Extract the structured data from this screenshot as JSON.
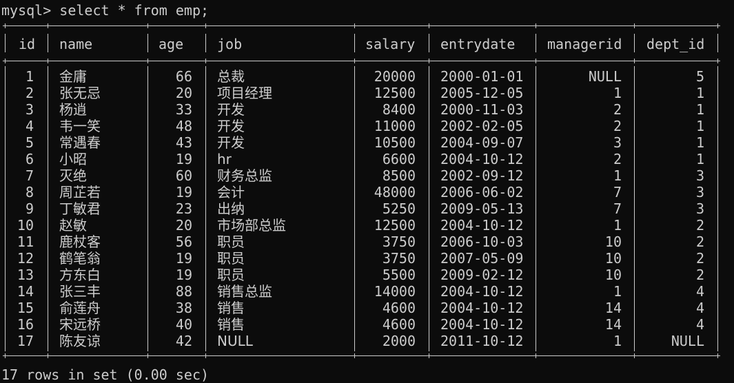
{
  "terminal": {
    "prompt": "mysql> ",
    "command": "select * from emp;",
    "summary": "17 rows in set (0.00 sec)"
  },
  "table": {
    "columns": [
      "id",
      "name",
      "age",
      "job",
      "salary",
      "entrydate",
      "managerid",
      "dept_id"
    ],
    "rows": [
      [
        "1",
        "金庸",
        "66",
        "总裁",
        "20000",
        "2000-01-01",
        "NULL",
        "5"
      ],
      [
        "2",
        "张无忌",
        "20",
        "项目经理",
        "12500",
        "2005-12-05",
        "1",
        "1"
      ],
      [
        "3",
        "杨逍",
        "33",
        "开发",
        "8400",
        "2000-11-03",
        "2",
        "1"
      ],
      [
        "4",
        "韦一笑",
        "48",
        "开发",
        "11000",
        "2002-02-05",
        "2",
        "1"
      ],
      [
        "5",
        "常遇春",
        "43",
        "开发",
        "10500",
        "2004-09-07",
        "3",
        "1"
      ],
      [
        "6",
        "小昭",
        "19",
        "hr",
        "6600",
        "2004-10-12",
        "2",
        "1"
      ],
      [
        "7",
        "灭绝",
        "60",
        "财务总监",
        "8500",
        "2002-09-12",
        "1",
        "3"
      ],
      [
        "8",
        "周芷若",
        "19",
        "会计",
        "48000",
        "2006-06-02",
        "7",
        "3"
      ],
      [
        "9",
        "丁敏君",
        "23",
        "出纳",
        "5250",
        "2009-05-13",
        "7",
        "3"
      ],
      [
        "10",
        "赵敏",
        "20",
        "市场部总监",
        "12500",
        "2004-10-12",
        "1",
        "2"
      ],
      [
        "11",
        "鹿杖客",
        "56",
        "职员",
        "3750",
        "2006-10-03",
        "10",
        "2"
      ],
      [
        "12",
        "鹤笔翁",
        "19",
        "职员",
        "3750",
        "2007-05-09",
        "10",
        "2"
      ],
      [
        "13",
        "方东白",
        "19",
        "职员",
        "5500",
        "2009-02-12",
        "10",
        "2"
      ],
      [
        "14",
        "张三丰",
        "88",
        "销售总监",
        "14000",
        "2004-10-12",
        "1",
        "4"
      ],
      [
        "15",
        "俞莲舟",
        "38",
        "销售",
        "4600",
        "2004-10-12",
        "14",
        "4"
      ],
      [
        "16",
        "宋远桥",
        "40",
        "销售",
        "4600",
        "2004-10-12",
        "14",
        "4"
      ],
      [
        "17",
        "陈友谅",
        "42",
        "NULL",
        "2000",
        "2011-10-12",
        "1",
        "NULL"
      ]
    ]
  },
  "colors": {
    "background": "#0c0c0c",
    "text": "#cccccc"
  }
}
